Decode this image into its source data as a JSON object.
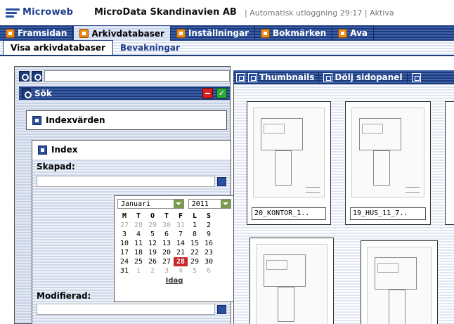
{
  "header": {
    "logo": "Microweb",
    "company": "MicroData Skandinavien AB",
    "meta": "| Automatisk utloggning  29:17 | Aktiva"
  },
  "topnav": {
    "tabs": [
      {
        "label": "Framsidan",
        "icon": "home-icon",
        "active": false
      },
      {
        "label": "Arkivdatabaser",
        "icon": "archive-icon",
        "active": true
      },
      {
        "label": "Inställningar",
        "icon": "tools-icon",
        "active": false
      },
      {
        "label": "Bokmärken",
        "icon": "bookmark-icon",
        "active": false
      },
      {
        "label": "Ava",
        "icon": "search-icon",
        "active": false
      }
    ]
  },
  "subnav": {
    "tabs": [
      {
        "label": "Visa arkivdatabaser",
        "active": true
      },
      {
        "label": "Bevakningar",
        "active": false
      }
    ]
  },
  "side": {
    "search_bar_title": "Sök",
    "indexvarden_title": "Indexvärden",
    "index_title": "Index",
    "skapad_label": "Skapad:",
    "modifierad_label": "Modifierad:"
  },
  "calendar": {
    "month": "Januari",
    "year": "2011",
    "day_headers": [
      "M",
      "T",
      "O",
      "T",
      "F",
      "L",
      "S"
    ],
    "weeks": [
      [
        "27",
        "28",
        "29",
        "30",
        "31",
        "1",
        "2"
      ],
      [
        "3",
        "4",
        "5",
        "6",
        "7",
        "8",
        "9"
      ],
      [
        "10",
        "11",
        "12",
        "13",
        "14",
        "15",
        "16"
      ],
      [
        "17",
        "18",
        "19",
        "20",
        "21",
        "22",
        "23"
      ],
      [
        "24",
        "25",
        "26",
        "27",
        "28",
        "29",
        "30"
      ],
      [
        "31",
        "1",
        "2",
        "3",
        "4",
        "5",
        "6"
      ]
    ],
    "today_label": "Idag",
    "selected_day": "28"
  },
  "main": {
    "toolbar": {
      "thumbnails_label": "Thumbnails",
      "hide_panel_label": "Dölj sidopanel"
    },
    "thumbnails": [
      {
        "label": "20_KONTOR_1.."
      },
      {
        "label": "19_HUS_11_7.."
      },
      {
        "label": ""
      },
      {
        "label": ""
      }
    ]
  }
}
